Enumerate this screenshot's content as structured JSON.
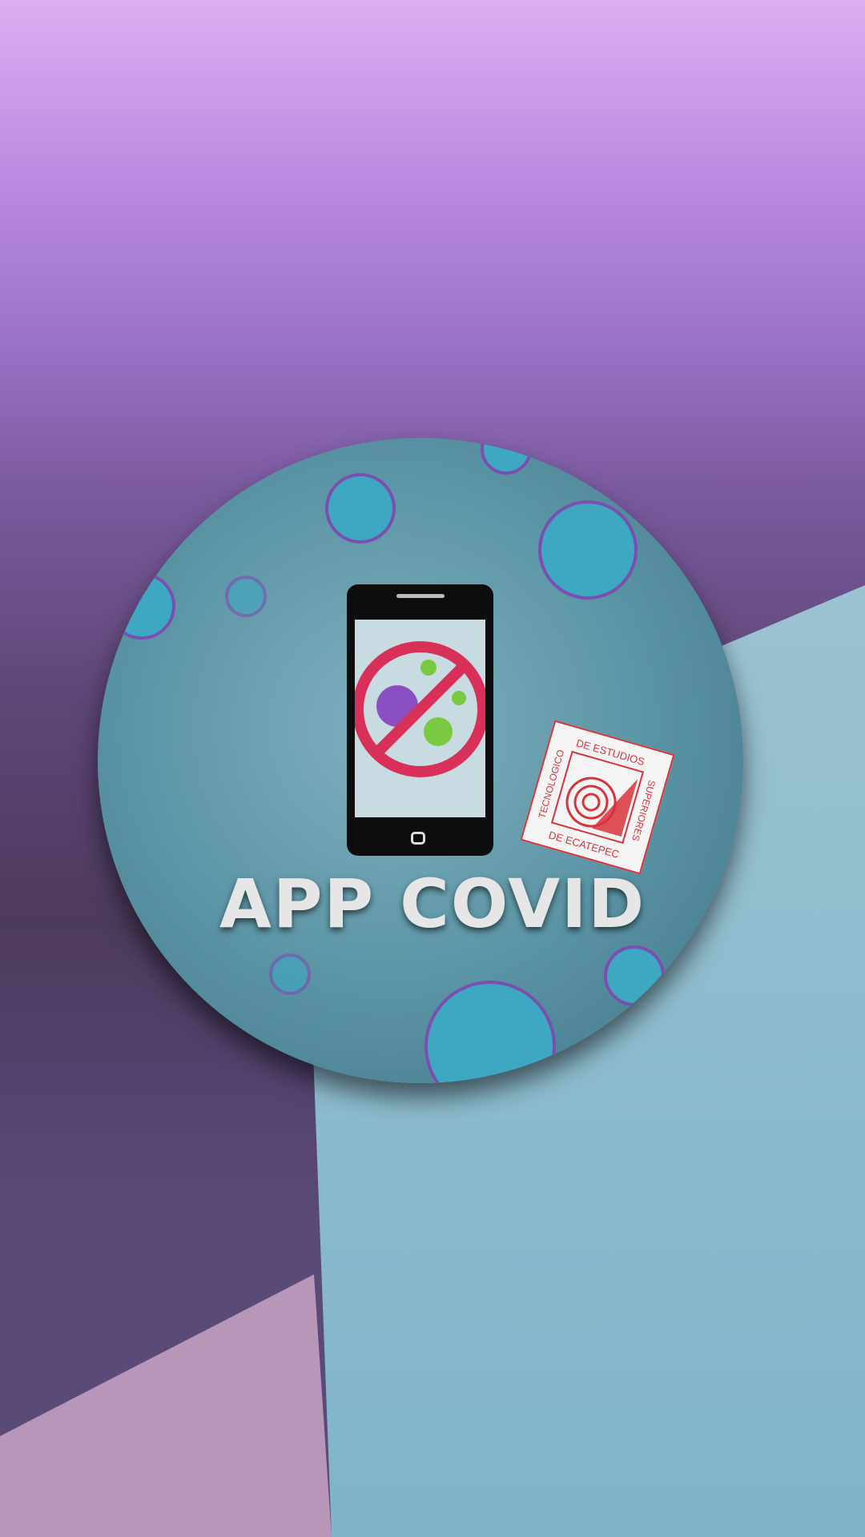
{
  "title": "APP COVID",
  "logo": {
    "name": "TECNOLÓGICO DE ESTUDIOS SUPERIORES DE ECATEPEC",
    "top": "DE ESTUDIOS",
    "left": "TECNOLOGICO",
    "right": "SUPERIORES",
    "bottom": "DE ECATEPEC"
  },
  "icons": [
    "phone-icon",
    "no-virus-icon",
    "virus-icon"
  ],
  "colors": {
    "accent": "#d8333a",
    "virus": "#7a3fb0",
    "title": "#e6e6e6"
  }
}
